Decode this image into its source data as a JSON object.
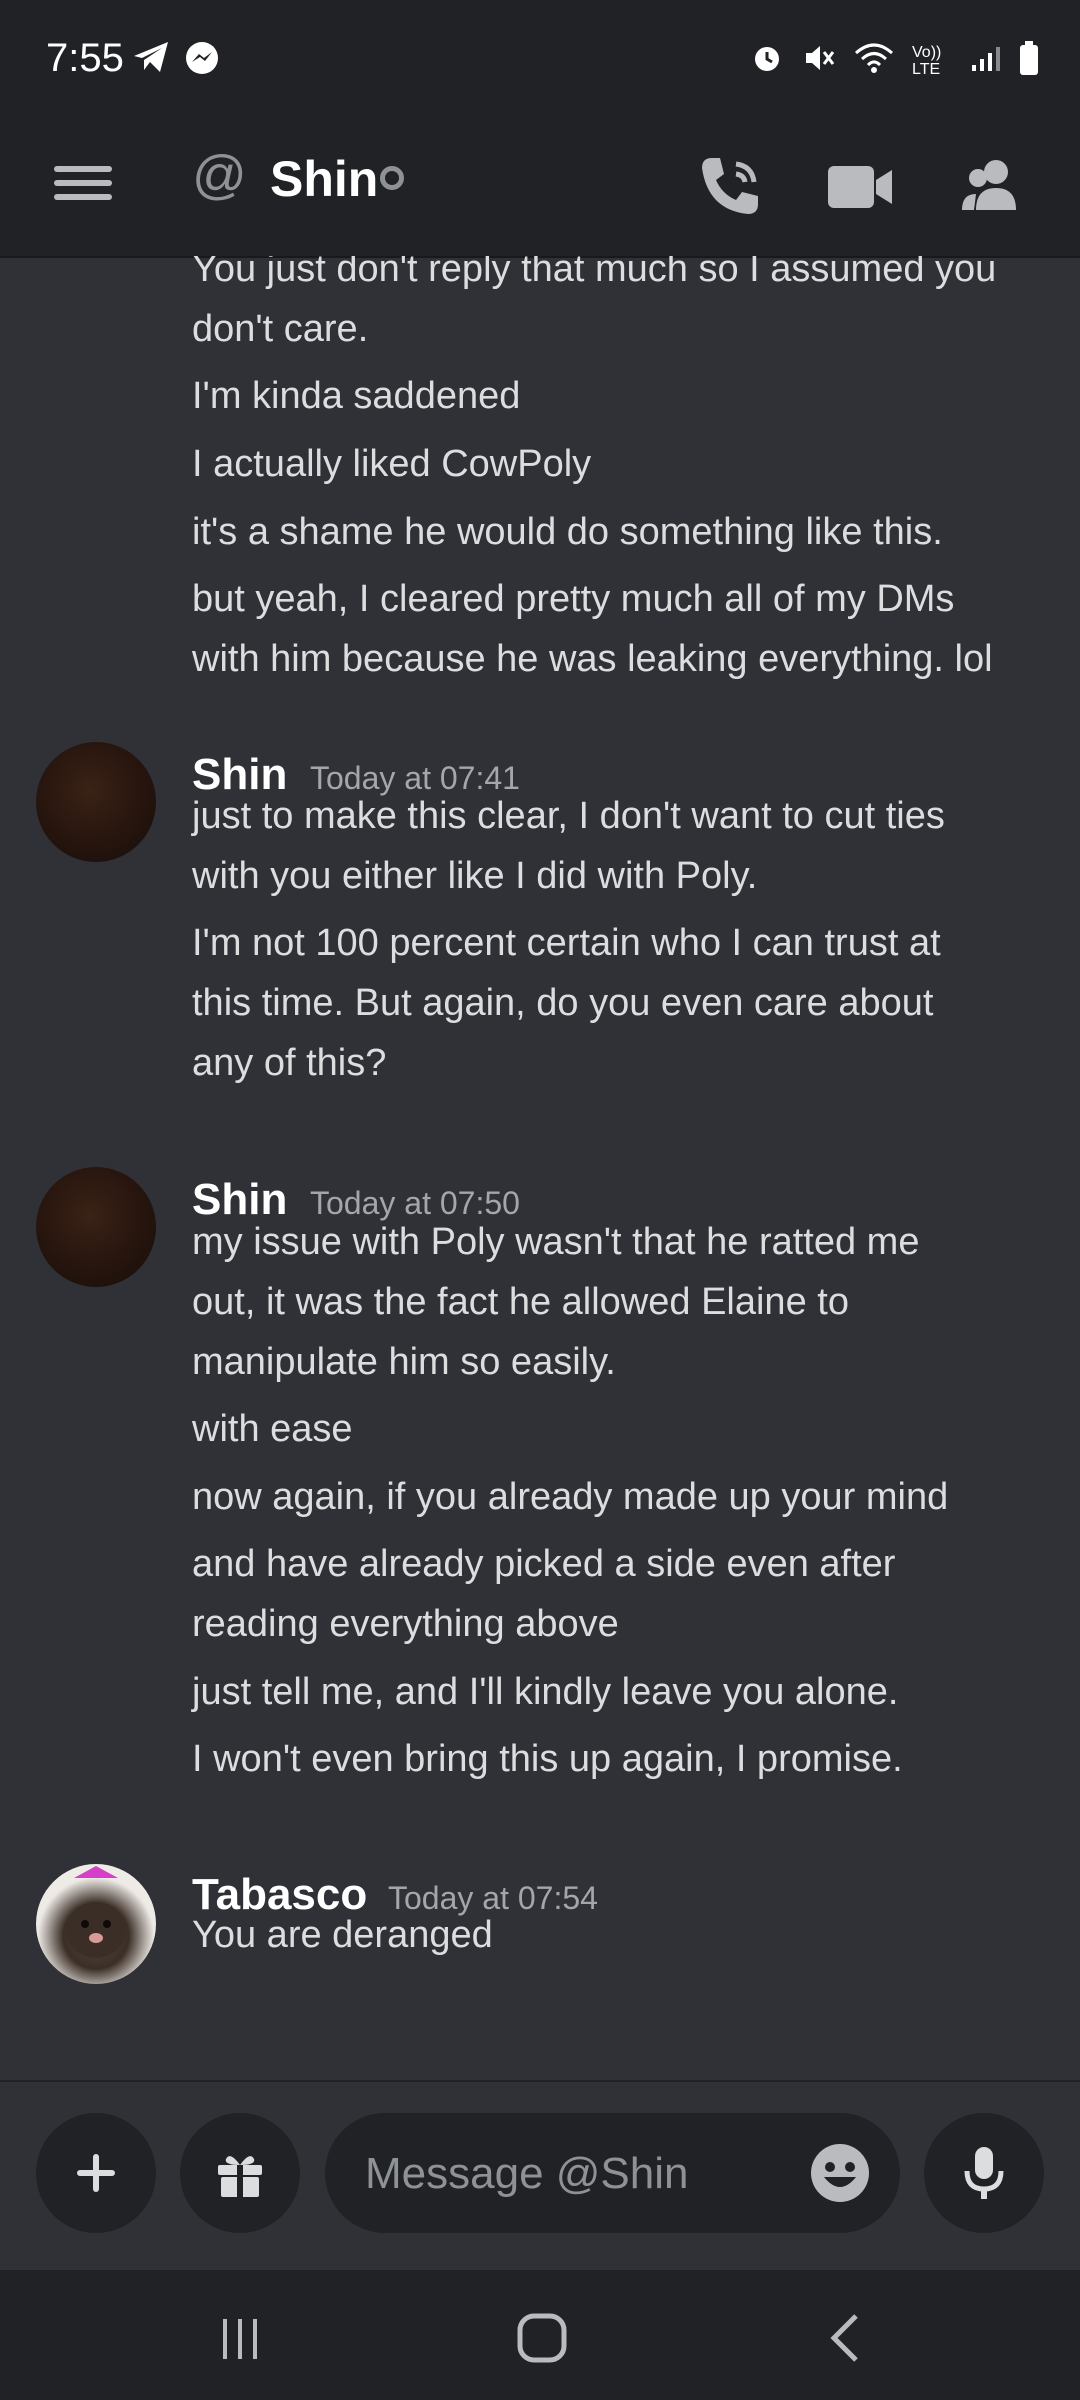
{
  "status_bar": {
    "time": "7:55",
    "left_icons": [
      "telegram-icon",
      "messenger-icon"
    ],
    "right_icons": [
      "alarm-icon",
      "mute-icon",
      "wifi-icon",
      "volte-icon",
      "signal-icon",
      "battery-icon"
    ],
    "volte_label": "Vo)) LTE"
  },
  "header": {
    "channel_icon": "@",
    "title": "Shin",
    "status": "offline"
  },
  "messages": {
    "continuation": [
      "You just don't reply that much so I assumed you",
      "don't care.",
      "I'm kinda saddened",
      "I actually liked CowPoly",
      "it's a shame he would do something like this.",
      "but yeah, I cleared pretty much all of my DMs",
      "with him because he was leaking everything. lol"
    ],
    "group1": {
      "author": "Shin",
      "timestamp": "Today at 07:41",
      "lines": [
        "just to make this clear, I don't want to cut ties",
        "with you either like I did with Poly.",
        "I'm not 100 percent certain who I can trust at",
        "this time. But again, do you even care about",
        "any of this?"
      ]
    },
    "group2": {
      "author": "Shin",
      "timestamp": "Today at 07:50",
      "lines": [
        "my issue with Poly wasn't that he ratted me",
        "out, it was the fact he allowed Elaine to",
        "manipulate him so easily.",
        "with ease",
        "now again, if you already made up your mind",
        "and have already picked a side even after",
        "reading everything above",
        "just tell me, and I'll kindly leave you alone.",
        "I won't even bring this up again, I promise."
      ]
    },
    "group3": {
      "author": "Tabasco",
      "timestamp": "Today at 07:54",
      "lines": [
        "You are deranged"
      ]
    }
  },
  "composer": {
    "placeholder": "Message @Shin"
  },
  "colors": {
    "background": "#2f3136",
    "header": "#202225",
    "text": "#dcddde",
    "muted": "#a3a6aa"
  }
}
